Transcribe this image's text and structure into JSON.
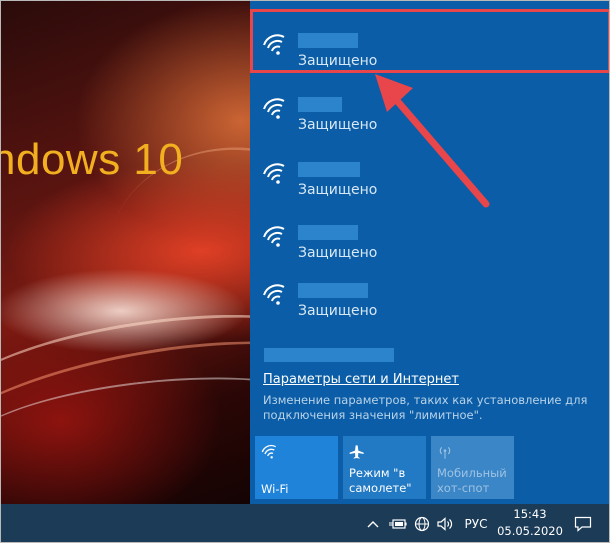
{
  "desktop": {
    "wallpaper_text": "ndows 10"
  },
  "networks": [
    {
      "status": "Защищено",
      "selected": true
    },
    {
      "status": "Защищено"
    },
    {
      "status": "Защищено"
    },
    {
      "status": "Защищено"
    },
    {
      "status": "Защищено"
    }
  ],
  "settings": {
    "link_label": "Параметры сети и Интернет",
    "description": "Изменение параметров, таких как установление для подключения значения \"лимитное\"."
  },
  "quick_actions": [
    {
      "icon": "wifi-icon",
      "label": "Wi-Fi",
      "state": "on"
    },
    {
      "icon": "airplane-icon",
      "label": "Режим \"в\nсамолете\"",
      "state": "off"
    },
    {
      "icon": "hotspot-icon",
      "label": "Мобильный\nхот-спот",
      "state": "disabled"
    }
  ],
  "taskbar": {
    "language": "РУС",
    "time": "15:43",
    "date": "05.05.2020"
  },
  "colors": {
    "flyout_bg": "#0a5da6",
    "highlight": "#e8464a",
    "taskbar_bg": "#1b3b57"
  }
}
